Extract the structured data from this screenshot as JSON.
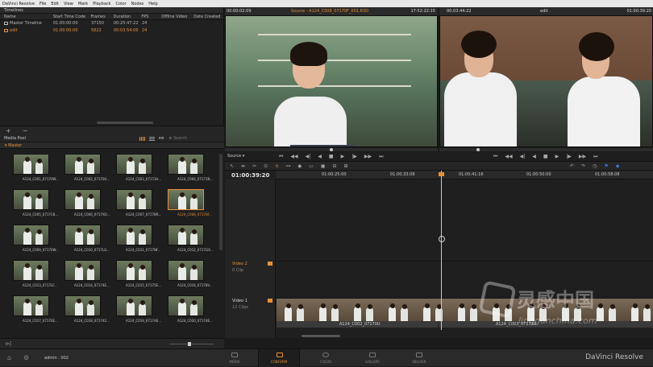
{
  "menu": [
    "DaVinci Resolve",
    "File",
    "Edit",
    "View",
    "Mark",
    "Playback",
    "Color",
    "Nodes",
    "Help"
  ],
  "timelines_panel": {
    "title": "Timelines",
    "columns": [
      "Name",
      "Start Time Code",
      "Frames",
      "Duration",
      "FPS",
      "Offline Video",
      "Date Created"
    ],
    "rows": [
      {
        "name": "Master Timeline",
        "start": "01:00:00:00",
        "frames": "37150",
        "duration": "00:25:47:22",
        "fps": "24"
      },
      {
        "name": "edit",
        "start": "01:00:00:00",
        "frames": "5822",
        "duration": "00:03:54:06",
        "fps": "24"
      }
    ]
  },
  "pool_bar": {
    "add": "+",
    "remove": "−"
  },
  "media_pool": {
    "title": "Media Pool",
    "search_placeholder": "Search",
    "folder": "Master",
    "clips": [
      "A124_C001_07170W...",
      "A124_C002_07170U...",
      "A124_C003_07173A...",
      "A124_C004_07171N...",
      "A124_C005_0717C8...",
      "A124_C006_0717XO...",
      "A124_C007_0717BR...",
      "A124_C008_07170F...",
      "A124_C009_07170W...",
      "A124_C010_0717LG...",
      "A124_C011_0717NF...",
      "A124_C012_0717GX...",
      "A124_C013_0717LF...",
      "A124_C014_07174E...",
      "A124_C015_07175E...",
      "A124_C016_07178V...",
      "A124_C017_0717EE...",
      "A124_C018_071742...",
      "A124_C019_0717AE...",
      "A124_C020_07174E..."
    ],
    "selected_index": 7
  },
  "left_bottom": {
    "volume": 0.42
  },
  "source_viewer": {
    "timecode_left": "00:00:02:09",
    "title": "Source - A124_C008_07170F_001.R3D",
    "timecode_right": "17:52:22:15",
    "mode": "Source",
    "scrub": 0.5
  },
  "timeline_viewer": {
    "timecode_left": "00:03:44:22",
    "title": "edit",
    "timecode_right": "01:00:39:20",
    "scrub": 0.18
  },
  "timeline": {
    "timecode": "01:00:39:20",
    "ruler": [
      "01:00:25:00",
      "01:00:33:08",
      "01:00:41:16",
      "01:00:50:00",
      "01:00:58:08"
    ],
    "tracks": [
      {
        "name": "Video 2",
        "clips": "0 Clip"
      },
      {
        "name": "Video 1",
        "clips": "12 Clips"
      }
    ],
    "clip_titles": [
      "A124_C002_07170U",
      "A124_C003_07173A"
    ]
  },
  "bottom_bar": {
    "user": "admin : 002",
    "pages": [
      "MEDIA",
      "CONFORM",
      "COLOR",
      "GALLERY",
      "DELIVER"
    ],
    "active_page": "CONFORM",
    "brand": "DaVinci Resolve"
  },
  "watermark": {
    "big": "灵感中国",
    "small": "lingganchina.com"
  },
  "colors": {
    "accent": "#e8903a",
    "panel": "#202020",
    "menubar": "#e8e8e8"
  }
}
